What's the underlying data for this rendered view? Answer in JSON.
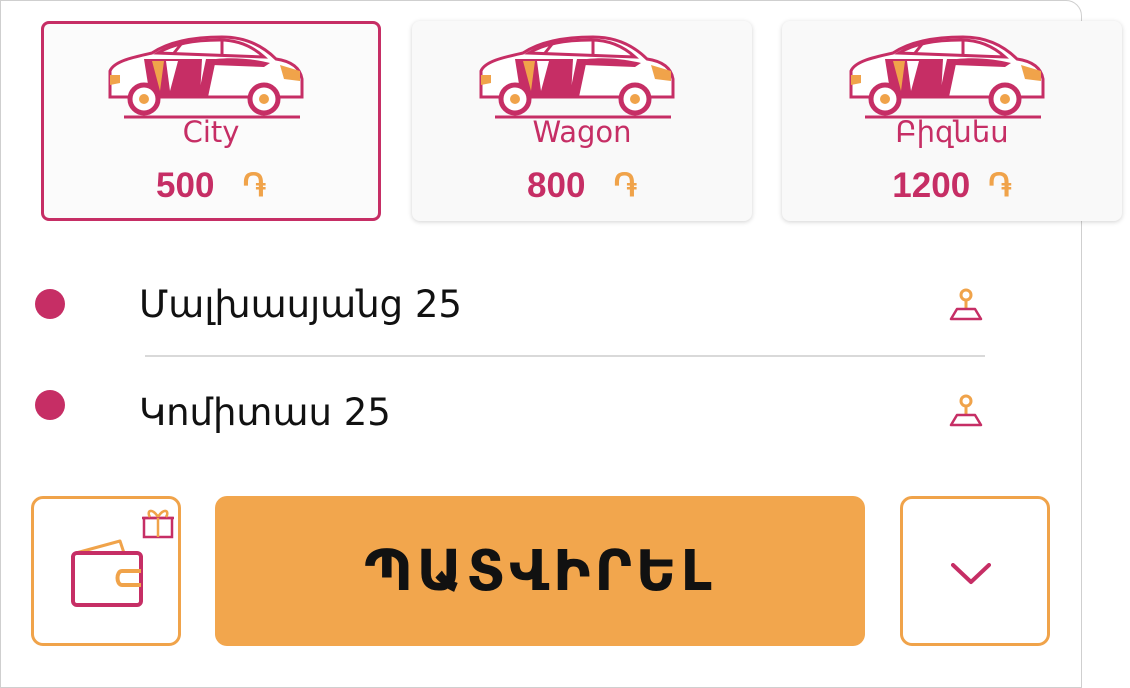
{
  "tariffs": [
    {
      "name": "City",
      "price": "500",
      "currency": "֏",
      "selected": true
    },
    {
      "name": "Wagon",
      "price": "800",
      "currency": "֏",
      "selected": false
    },
    {
      "name": "Բիզնես",
      "price": "1200",
      "currency": "֏",
      "selected": false
    }
  ],
  "route": {
    "from": "Մալխասյանց 25",
    "to": "Կոմիտաս 25"
  },
  "actions": {
    "order_label": "ՊԱՏՎԻՐԵԼ"
  },
  "colors": {
    "accent": "#c62e65",
    "primary": "#f2a64d"
  }
}
